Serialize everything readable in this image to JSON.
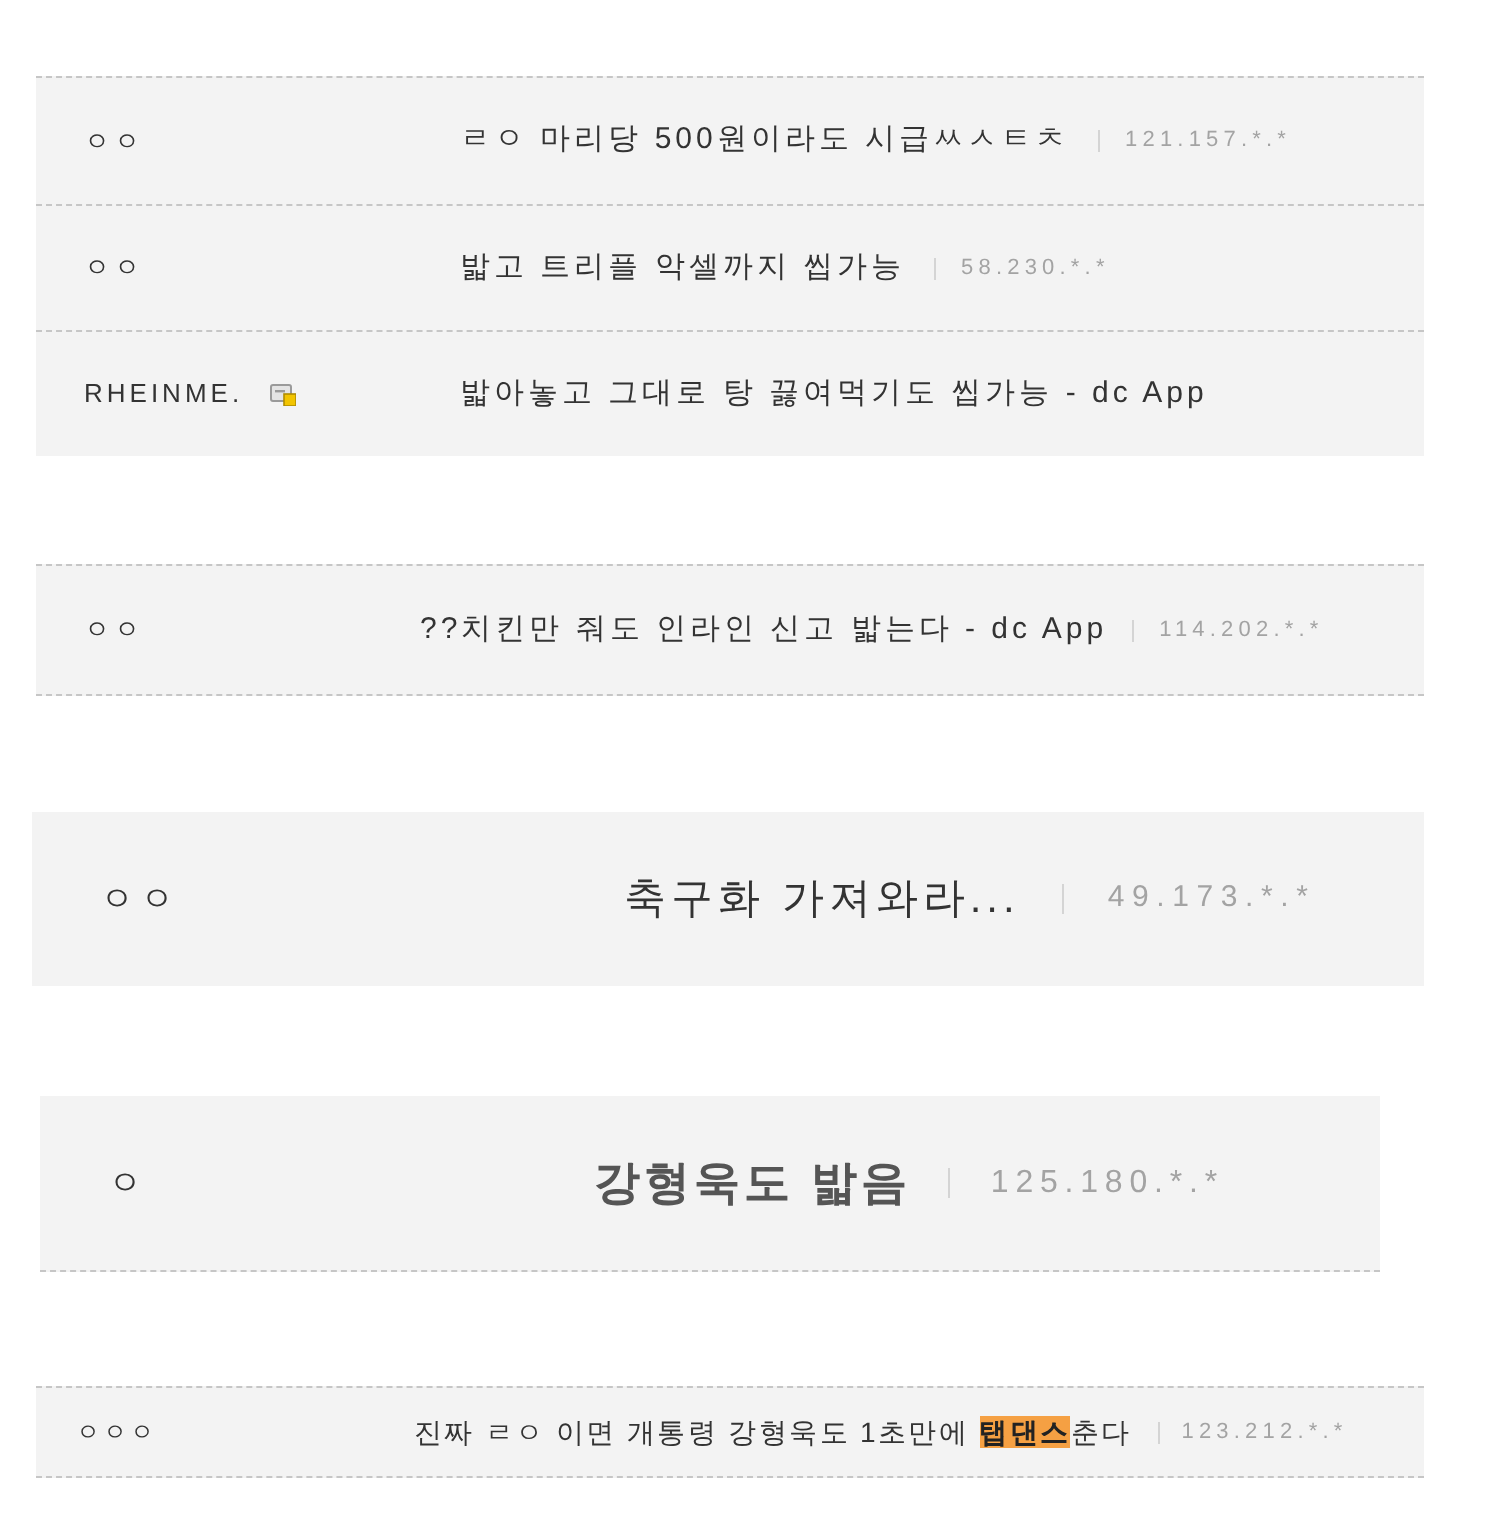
{
  "clips": [
    {
      "comments": [
        {
          "name": "ㅇㅇ",
          "member": false,
          "text": "ㄹㅇ 마리당 500원이라도 시급ㅆㅅㅌㅊ",
          "ip": "121.157.*.*"
        },
        {
          "name": "ㅇㅇ",
          "member": false,
          "text": "밟고 트리플 악셀까지 씹가능",
          "ip": "58.230.*.*"
        },
        {
          "name": "RHEINME.",
          "member": true,
          "text": "밟아놓고 그대로 탕 끓여먹기도 씹가능 - dc App"
        }
      ]
    },
    {
      "comments": [
        {
          "name": "ㅇㅇ",
          "member": false,
          "text": "??치킨만 줘도 인라인 신고 밟는다 - dc App",
          "ip": "114.202.*.*"
        }
      ]
    },
    {
      "comments": [
        {
          "name": "ㅇㅇ",
          "member": false,
          "text": "축구화 가져와라...",
          "ip": "49.173.*.*"
        }
      ]
    },
    {
      "comments": [
        {
          "name": "ㅇ",
          "member": false,
          "text": "강형욱도 밟음",
          "ip": "125.180.*.*"
        }
      ]
    },
    {
      "comments": [
        {
          "name": "ㅇㅇㅇ",
          "member": false,
          "text": "진짜 ㄹㅇ 이면 개통령 강형욱도 1초만에 **탭댄스**춘다",
          "ip": "123.212.*.*"
        }
      ]
    }
  ]
}
